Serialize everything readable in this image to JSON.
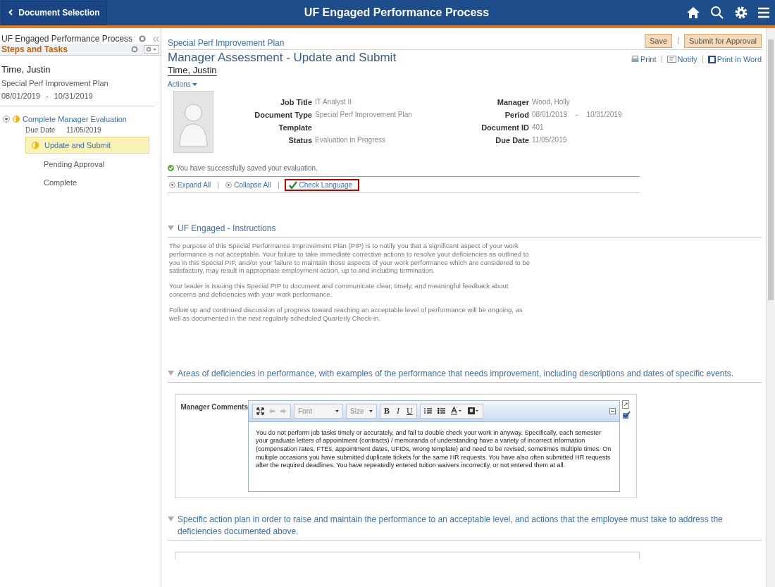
{
  "header": {
    "back_button": "Document Selection",
    "title": "UF Engaged Performance Process"
  },
  "sidebar": {
    "title": "UF Engaged Performance Process",
    "steps_label": "Steps and Tasks",
    "employee": "Time, Justin",
    "document_type": "Special Perf Improvement Plan",
    "period_start": "08/01/2019",
    "period_separator": "-",
    "period_end": "10/31/2019",
    "tasks": [
      {
        "label": "Complete Manager Evaluation",
        "in_progress": true,
        "expanded": true,
        "due_label": "Due Date",
        "due_date": "11/05/2019",
        "children": [
          {
            "label": "Update and Submit",
            "in_progress": true,
            "selected": true
          },
          {
            "label": "Pending Approval",
            "in_progress": false,
            "selected": false
          },
          {
            "label": "Complete",
            "in_progress": false,
            "selected": false
          }
        ]
      }
    ]
  },
  "main": {
    "breadcrumb": "Special Perf Improvement Plan",
    "buttons": [
      "Save",
      "Submit for Approval"
    ],
    "title": "Manager Assessment - Update and Submit",
    "links": [
      {
        "kind": "print",
        "label": "Print"
      },
      {
        "kind": "notify",
        "label": "Notify"
      },
      {
        "kind": "word",
        "label": "Print in Word"
      }
    ],
    "employee": "Time, Justin",
    "actions": "Actions",
    "fields_left": [
      {
        "label": "Job Title",
        "value": "IT Analyst II"
      },
      {
        "label": "Document Type",
        "value": "Special Perf Improvement Plan"
      },
      {
        "label": "Template"
      },
      {
        "label": "Status",
        "value": "Evaluation in Progress"
      }
    ],
    "fields_right": [
      {
        "label": "Manager",
        "value": "Wood, Holly"
      },
      {
        "label": "Period",
        "value": "08/01/2019",
        "separator": "-",
        "value_end": "10/31/2019"
      },
      {
        "label": "Document ID",
        "value": "401"
      },
      {
        "label": "Due Date",
        "value": "11/05/2019"
      }
    ],
    "message": "You have successfully saved your evaluation.",
    "toolbar": [
      {
        "kind": "expand",
        "label": "Expand All",
        "highlighted": false
      },
      {
        "kind": "collapse",
        "label": "Collapse All",
        "highlighted": false
      },
      {
        "kind": "check",
        "label": "Check Language",
        "highlighted": true
      }
    ],
    "sections": [
      {
        "title": "UF Engaged - Instructions",
        "expanded": true,
        "paragraphs": [
          "The purpose of this Special Performance Improvement Plan (PIP) is to notify you that a significant aspect of your work performance is not acceptable. Your failure to take immediate corrective actions to resolve your deficiencies as outlined to you in this Special PIP, and/or your failure to maintain those aspects of your work performance which are considered to be satisfactory, may result in appropriate employment action, up to and including termination.",
          "Your leader is issuing this Special PIP to document and communicate clear, timely, and meaningful feedback about concerns and deficiencies with your work performance.",
          "Follow up and continued discussion of progress toward reaching an acceptable level of performance will be ongoing, as well as documented in the next regularly scheduled Quarterly Check-in."
        ]
      },
      {
        "title": "Areas of deficiencies in performance, with examples of the performance that needs improvement, including descriptions and dates of specific events.",
        "expanded": true,
        "comment": {
          "label": "Manager Comments",
          "font": "Font",
          "size": "Size",
          "bold": "B",
          "italic": "I",
          "underline": "U",
          "text": "You do not perform job tasks timely or accurately, and fail to double check your work in anyway.  Specifically, each semester your graduate letters of appointment (contracts) / memoranda of understanding have a variety of incorrect information (compensation rates, FTEs, appointment dates, UFIDs, wrong template) and need to be revised, sometimes multiple times. On multiple occasions you have submitted duplicate tickets for the same HR requests. You have also often submitted HR requests after the required deadlines. You have repeatedly entered tuition waivers incorrectly, or not entered them at all."
        }
      },
      {
        "title": "Specific action plan in order to raise and maintain the performance to an acceptable level, and actions that the employee must take to address the deficiencies documented above.",
        "expanded": true,
        "comment_panel": true
      }
    ]
  }
}
